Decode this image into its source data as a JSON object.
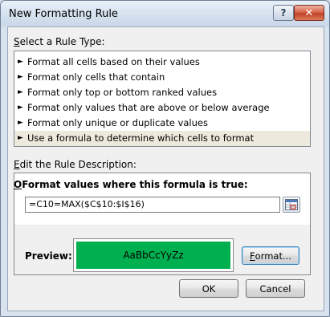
{
  "window": {
    "title": "New Formatting Rule",
    "help_label": "?",
    "close_label": "✕"
  },
  "rule_type": {
    "heading_prefix": "S",
    "heading_rest": "elect a Rule Type:",
    "items": [
      {
        "label": "Format all cells based on their values"
      },
      {
        "label": "Format only cells that contain"
      },
      {
        "label": "Format only top or bottom ranked values"
      },
      {
        "label": "Format only values that are above or below average"
      },
      {
        "label": "Format only unique or duplicate values"
      },
      {
        "label": "Use a formula to determine which cells to format"
      }
    ],
    "selected_index": 5,
    "bullet": "►"
  },
  "description": {
    "heading_prefix": "E",
    "heading_rest": "dit the Rule Description:",
    "formula_heading_prefix": "O",
    "formula_heading_rest": "Format values where this formula is true:",
    "formula_value": "=C10=MAX($C$10:$I$16)",
    "preview_label": "Preview:",
    "preview_sample": "AaBbCcYyZz",
    "preview_fill_color": "#00b050",
    "format_button_prefix": "F",
    "format_button_rest": "ormat..."
  },
  "footer": {
    "ok_label": "OK",
    "cancel_label": "Cancel"
  }
}
